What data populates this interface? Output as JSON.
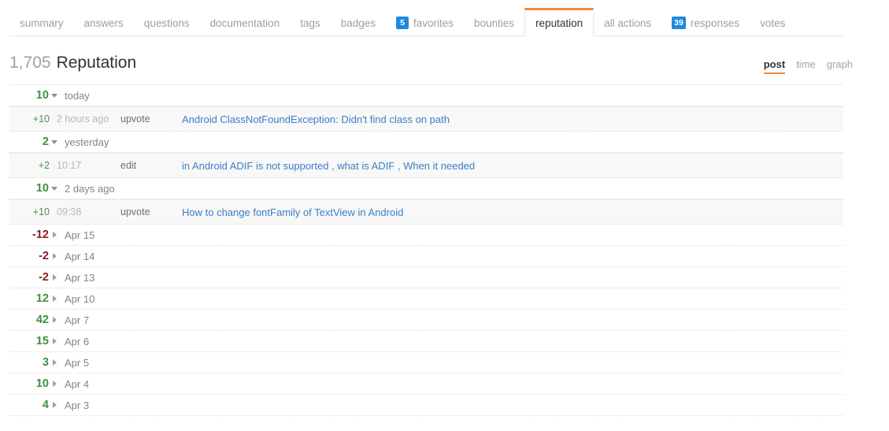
{
  "tabs": [
    {
      "label": "summary",
      "badge": null,
      "active": false
    },
    {
      "label": "answers",
      "badge": null,
      "active": false
    },
    {
      "label": "questions",
      "badge": null,
      "active": false
    },
    {
      "label": "documentation",
      "badge": null,
      "active": false
    },
    {
      "label": "tags",
      "badge": null,
      "active": false
    },
    {
      "label": "badges",
      "badge": null,
      "active": false
    },
    {
      "label": "favorites",
      "badge": "5",
      "active": false
    },
    {
      "label": "bounties",
      "badge": null,
      "active": false
    },
    {
      "label": "reputation",
      "badge": null,
      "active": true
    },
    {
      "label": "all actions",
      "badge": null,
      "active": false
    },
    {
      "label": "responses",
      "badge": "39",
      "active": false
    },
    {
      "label": "votes",
      "badge": null,
      "active": false
    }
  ],
  "header": {
    "count": "1,705",
    "title": "Reputation"
  },
  "view_switch": {
    "options": [
      {
        "label": "post",
        "active": true
      },
      {
        "label": "time",
        "active": false
      },
      {
        "label": "graph",
        "active": false
      }
    ]
  },
  "colors": {
    "accent": "#f0883b",
    "badge": "#1e8ae0",
    "positive": "#3f8f46",
    "negative": "#8c1a1a",
    "link": "#3b7fc4"
  },
  "rows": [
    {
      "kind": "group",
      "value": "10",
      "sign": "pos",
      "expanded": true,
      "label": "today"
    },
    {
      "kind": "detail",
      "value": "+10",
      "sign": "pos",
      "time": "2 hours ago",
      "action": "upvote",
      "link": "Android ClassNotFoundException: Didn't find class on path"
    },
    {
      "kind": "group",
      "value": "2",
      "sign": "pos",
      "expanded": true,
      "label": "yesterday"
    },
    {
      "kind": "detail",
      "value": "+2",
      "sign": "pos",
      "time": "10:17",
      "action": "edit",
      "link": "in Android ADIF is not supported , what is ADIF , When it needed"
    },
    {
      "kind": "group",
      "value": "10",
      "sign": "pos",
      "expanded": true,
      "label": "2 days ago"
    },
    {
      "kind": "detail",
      "value": "+10",
      "sign": "pos",
      "time": "09:38",
      "action": "upvote",
      "link": "How to change fontFamily of TextView in Android"
    },
    {
      "kind": "group",
      "value": "-12",
      "sign": "neg",
      "expanded": false,
      "label": "Apr 15"
    },
    {
      "kind": "group",
      "value": "-2",
      "sign": "neg",
      "expanded": false,
      "label": "Apr 14"
    },
    {
      "kind": "group",
      "value": "-2",
      "sign": "neg",
      "expanded": false,
      "label": "Apr 13"
    },
    {
      "kind": "group",
      "value": "12",
      "sign": "pos",
      "expanded": false,
      "label": "Apr 10"
    },
    {
      "kind": "group",
      "value": "42",
      "sign": "pos",
      "expanded": false,
      "label": "Apr 7"
    },
    {
      "kind": "group",
      "value": "15",
      "sign": "pos",
      "expanded": false,
      "label": "Apr 6"
    },
    {
      "kind": "group",
      "value": "3",
      "sign": "pos",
      "expanded": false,
      "label": "Apr 5"
    },
    {
      "kind": "group",
      "value": "10",
      "sign": "pos",
      "expanded": false,
      "label": "Apr 4"
    },
    {
      "kind": "group",
      "value": "4",
      "sign": "pos",
      "expanded": false,
      "label": "Apr 3"
    }
  ]
}
